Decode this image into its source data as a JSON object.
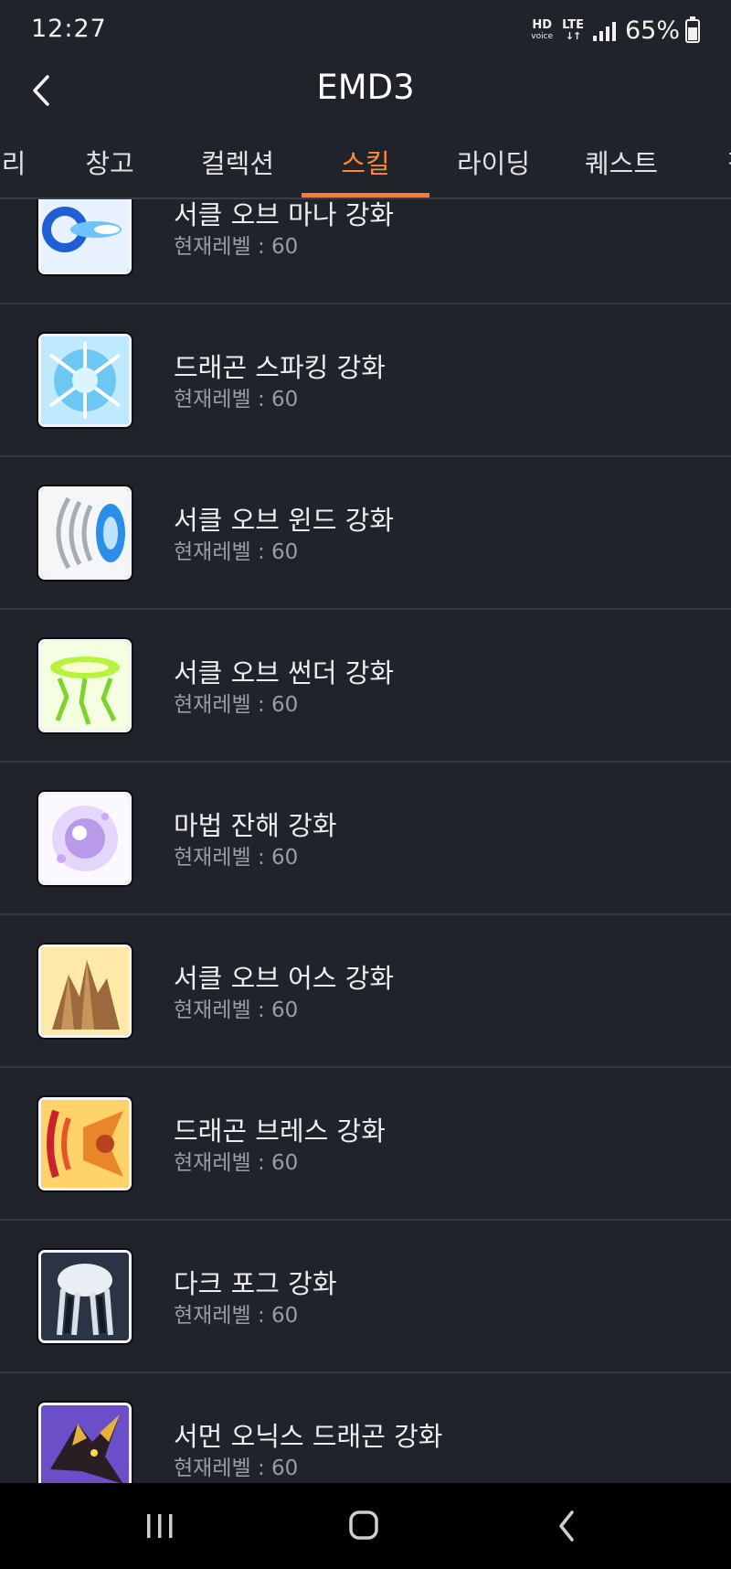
{
  "status": {
    "time": "12:27",
    "hd": "HD",
    "voice": "voice",
    "lte": "LTE",
    "battery": "65%"
  },
  "header": {
    "title": "EMD3"
  },
  "tabs": [
    "리",
    "창고",
    "컬렉션",
    "스킬",
    "라이딩",
    "퀘스트",
    "펫"
  ],
  "active_tab": "스킬",
  "skills": [
    {
      "name": "서클 오브 마나 강화",
      "level": "현재레벨 : 60",
      "icon": "mana-circle-icon"
    },
    {
      "name": "드래곤 스파킹 강화",
      "level": "현재레벨 : 60",
      "icon": "dragon-sparking-icon"
    },
    {
      "name": "서클 오브 윈드 강화",
      "level": "현재레벨 : 60",
      "icon": "wind-circle-icon"
    },
    {
      "name": "서클 오브 썬더 강화",
      "level": "현재레벨 : 60",
      "icon": "thunder-circle-icon"
    },
    {
      "name": "마법 잔해 강화",
      "level": "현재레벨 : 60",
      "icon": "magic-debris-icon"
    },
    {
      "name": "서클 오브 어스 강화",
      "level": "현재레벨 : 60",
      "icon": "earth-circle-icon"
    },
    {
      "name": "드래곤 브레스 강화",
      "level": "현재레벨 : 60",
      "icon": "dragon-breath-icon"
    },
    {
      "name": "다크 포그 강화",
      "level": "현재레벨 : 60",
      "icon": "dark-fog-icon"
    },
    {
      "name": "서먼 오닉스 드래곤 강화",
      "level": "현재레벨 : 60",
      "icon": "onyx-dragon-icon"
    }
  ],
  "colors": {
    "background": "#20232a",
    "accent": "#ff7a2e",
    "divider": "#343741",
    "muted_text": "#9a9da4"
  }
}
